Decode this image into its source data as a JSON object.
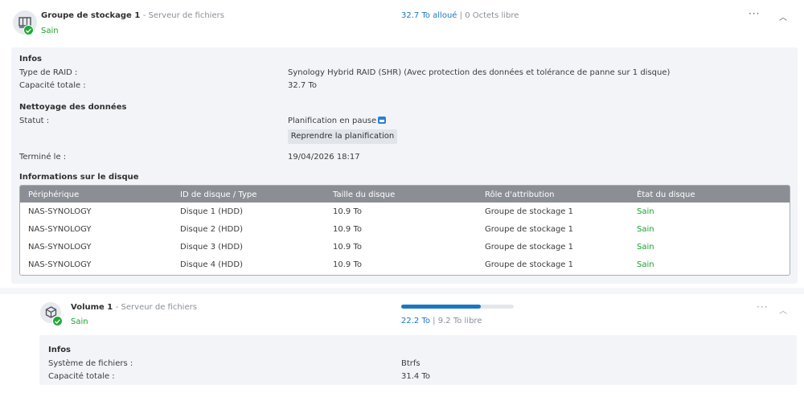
{
  "storage_pool": {
    "title": "Groupe de stockage 1",
    "subtitle": "- Serveur de fichiers",
    "status": "Sain",
    "allocated": "32.7 To alloué",
    "separator": "|",
    "free": "0 Octets libre",
    "more_icon": "ellipsis-icon",
    "collapse_icon": "chevron-up-icon",
    "infos": {
      "heading": "Infos",
      "raid_type_label": "Type de RAID :",
      "raid_type_value": "Synology Hybrid RAID (SHR) (Avec protection des données et tolérance de panne sur 1 disque)",
      "capacity_label": "Capacité totale :",
      "capacity_value": "32.7 To"
    },
    "scrubbing": {
      "heading": "Nettoyage des données",
      "status_label": "Statut :",
      "status_value": "Planification en pause",
      "schedule_icon": "calendar-icon",
      "resume_button": "Reprendre la planification",
      "finished_label": "Terminé le :",
      "finished_value": "19/04/2026 18:17"
    },
    "disk_info": {
      "heading": "Informations sur le disque",
      "columns": [
        "Périphérique",
        "ID de disque / Type",
        "Taille du disque",
        "Rôle d'attribution",
        "État du disque"
      ],
      "rows": [
        {
          "device": "NAS-SYNOLOGY",
          "disk": "Disque 1 (HDD)",
          "size": "10.9 To",
          "role": "Groupe de stockage 1",
          "state": "Sain"
        },
        {
          "device": "NAS-SYNOLOGY",
          "disk": "Disque 2 (HDD)",
          "size": "10.9 To",
          "role": "Groupe de stockage 1",
          "state": "Sain"
        },
        {
          "device": "NAS-SYNOLOGY",
          "disk": "Disque 3 (HDD)",
          "size": "10.9 To",
          "role": "Groupe de stockage 1",
          "state": "Sain"
        },
        {
          "device": "NAS-SYNOLOGY",
          "disk": "Disque 4 (HDD)",
          "size": "10.9 To",
          "role": "Groupe de stockage 1",
          "state": "Sain"
        }
      ]
    }
  },
  "volume": {
    "title": "Volume 1",
    "subtitle": "- Serveur de fichiers",
    "status": "Sain",
    "used": "22.2 To",
    "separator": "|",
    "free": "9.2 To libre",
    "usage_fraction": 0.71,
    "more_icon": "ellipsis-icon",
    "collapse_icon": "chevron-up-icon",
    "infos": {
      "heading": "Infos",
      "fs_label": "Système de fichiers :",
      "fs_value": "Btrfs",
      "capacity_label": "Capacité totale :",
      "capacity_value": "31.4 To"
    }
  },
  "colors": {
    "accent": "#1a78c2",
    "healthy": "#1aa12f",
    "table_header": "#8b8f95",
    "panel_bg": "#f2f4f7"
  }
}
